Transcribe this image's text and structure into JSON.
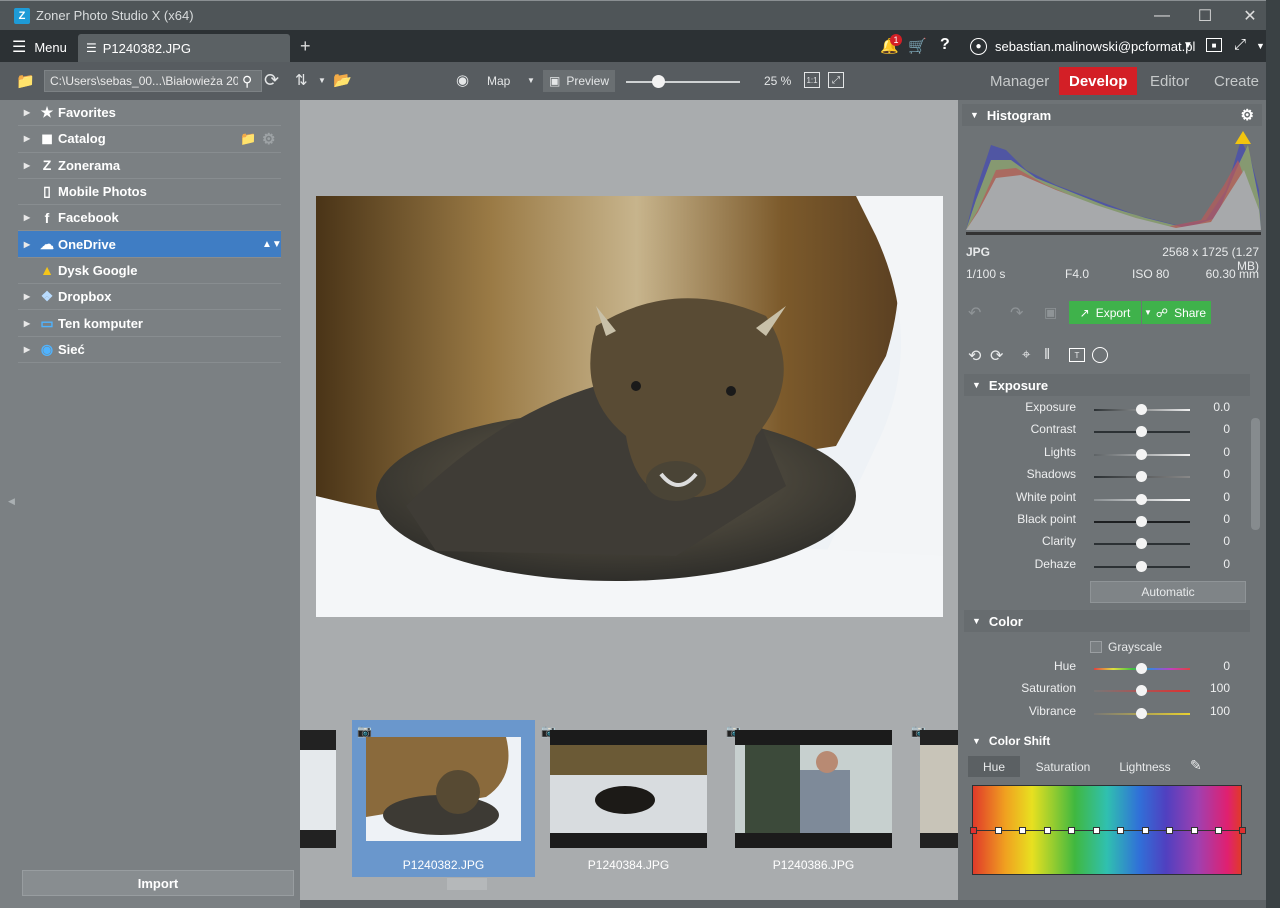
{
  "window": {
    "title": "Zoner Photo Studio X (x64)",
    "app_icon": "Z"
  },
  "tabbar": {
    "menu_label": "Menu",
    "tab_label": "P1240382.JPG",
    "notification_count": "1",
    "user_email": "sebastian.malinowski@pcformat.pl"
  },
  "toolbar": {
    "path": "C:\\Users\\sebas_00...\\Białowieża 2017",
    "map_label": "Map",
    "preview_label": "Preview",
    "zoom_value": "25 %",
    "zoom_fraction": 0.25,
    "one_to_one": "1:1"
  },
  "modes": {
    "manager": "Manager",
    "develop": "Develop",
    "editor": "Editor",
    "create": "Create"
  },
  "navigator": {
    "items": [
      {
        "label": "Favorites",
        "icon": "star-icon"
      },
      {
        "label": "Catalog",
        "icon": "catalog-icon"
      },
      {
        "label": "Zonerama",
        "icon": "zonerama-icon"
      },
      {
        "label": "Mobile Photos",
        "icon": "phone-icon"
      },
      {
        "label": "Facebook",
        "icon": "facebook-icon"
      },
      {
        "label": "OneDrive",
        "icon": "cloud-icon"
      },
      {
        "label": "Dysk Google",
        "icon": "google-drive-icon"
      },
      {
        "label": "Dropbox",
        "icon": "dropbox-icon"
      },
      {
        "label": "Ten komputer",
        "icon": "computer-icon"
      },
      {
        "label": "Sieć",
        "icon": "network-icon"
      }
    ],
    "import_label": "Import"
  },
  "filmstrip": [
    {
      "label": "P1240382.JPG",
      "selected": true
    },
    {
      "label": "P1240384.JPG",
      "selected": false
    },
    {
      "label": "P1240386.JPG",
      "selected": false
    }
  ],
  "histogram": {
    "title": "Histogram",
    "format": "JPG",
    "dimensions": "2568 x 1725 (1.27 MB)",
    "shutter": "1/100 s",
    "aperture": "F4.0",
    "iso": "ISO 80",
    "focal": "60.30 mm"
  },
  "actions": {
    "export_label": "Export",
    "share_label": "Share"
  },
  "exposure": {
    "title": "Exposure",
    "sliders": [
      {
        "label": "Exposure",
        "value": "0.0"
      },
      {
        "label": "Contrast",
        "value": "0"
      },
      {
        "label": "Lights",
        "value": "0"
      },
      {
        "label": "Shadows",
        "value": "0"
      },
      {
        "label": "White point",
        "value": "0"
      },
      {
        "label": "Black point",
        "value": "0"
      },
      {
        "label": "Clarity",
        "value": "0"
      },
      {
        "label": "Dehaze",
        "value": "0"
      }
    ],
    "automatic_label": "Automatic"
  },
  "color": {
    "title": "Color",
    "grayscale_label": "Grayscale",
    "sliders": [
      {
        "label": "Hue",
        "value": "0"
      },
      {
        "label": "Saturation",
        "value": "100"
      },
      {
        "label": "Vibrance",
        "value": "100"
      }
    ]
  },
  "color_shift": {
    "title": "Color Shift",
    "tabs": [
      "Hue",
      "Saturation",
      "Lightness"
    ]
  },
  "colors": {
    "accent_red": "#d31f26",
    "selection_blue": "#3f7dc4",
    "green": "#3fb24b"
  }
}
